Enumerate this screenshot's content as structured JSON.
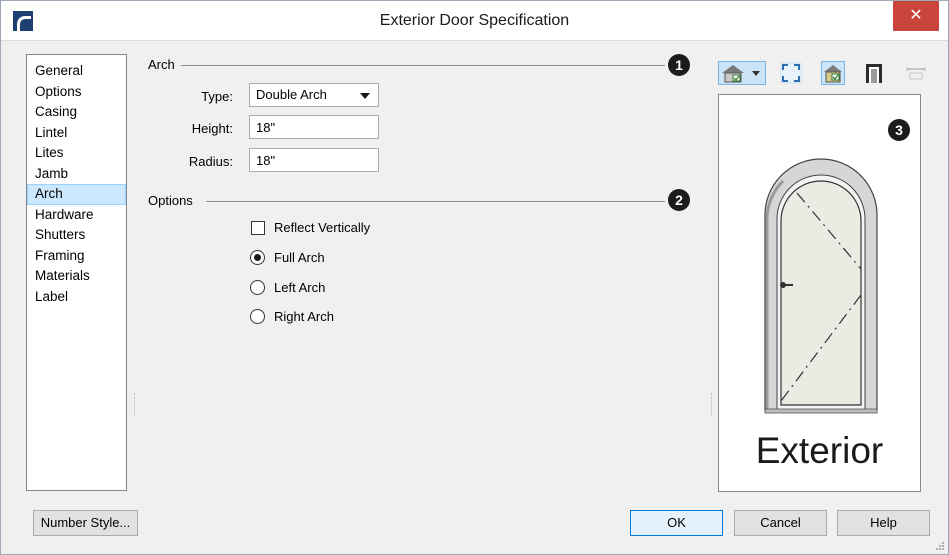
{
  "window": {
    "title": "Exterior Door Specification",
    "close_glyph": "✕"
  },
  "nav": {
    "items": [
      {
        "label": "General"
      },
      {
        "label": "Options"
      },
      {
        "label": "Casing"
      },
      {
        "label": "Lintel"
      },
      {
        "label": "Lites"
      },
      {
        "label": "Jamb"
      },
      {
        "label": "Arch",
        "selected": true
      },
      {
        "label": "Hardware"
      },
      {
        "label": "Shutters"
      },
      {
        "label": "Framing"
      },
      {
        "label": "Materials"
      },
      {
        "label": "Label"
      }
    ]
  },
  "arch": {
    "group_label": "Arch",
    "callout": "1",
    "type_label": "Type:",
    "type_value": "Double Arch",
    "height_label": "Height:",
    "height_value": "18\"",
    "radius_label": "Radius:",
    "radius_value": "18\""
  },
  "options": {
    "group_label": "Options",
    "callout": "2",
    "reflect_label": "Reflect Vertically",
    "reflect_checked": false,
    "radios": [
      {
        "label": "Full Arch",
        "checked": true
      },
      {
        "label": "Left Arch",
        "checked": false
      },
      {
        "label": "Right Arch",
        "checked": false
      }
    ]
  },
  "preview": {
    "callout": "3",
    "caption": "Exterior",
    "toolbar_icons": [
      "house-view-dropdown-icon",
      "fit-view-icon",
      "house-toggle-icon",
      "door-frame-icon",
      "dimension-icon"
    ]
  },
  "buttons": {
    "number_style": "Number Style...",
    "ok": "OK",
    "cancel": "Cancel",
    "help": "Help"
  },
  "colors": {
    "close_button": "#c9453c",
    "selection": "#cce8ff",
    "default_button_border": "#0078d7",
    "door_panel": "#ecebe3",
    "frame": "#d4d4d4"
  }
}
